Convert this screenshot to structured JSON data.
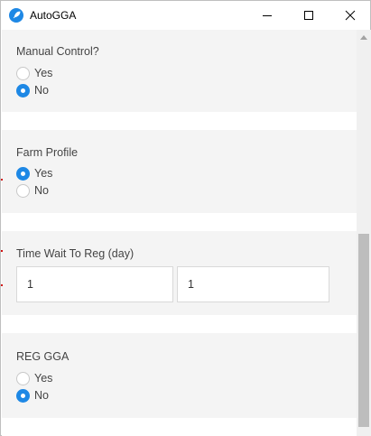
{
  "window": {
    "title": "AutoGGA",
    "icon": "rocket-icon",
    "controls": [
      "minimize-icon",
      "maximize-icon",
      "close-icon"
    ]
  },
  "colors": {
    "accent": "#1e88e5",
    "section_bg": "#f4f4f4",
    "page_bg": "#ffffff"
  },
  "form": {
    "manual_control": {
      "label": "Manual Control?",
      "options": [
        {
          "label": "Yes",
          "selected": false
        },
        {
          "label": "No",
          "selected": true
        }
      ]
    },
    "farm_profile": {
      "label": "Farm Profile",
      "options": [
        {
          "label": "Yes",
          "selected": true
        },
        {
          "label": "No",
          "selected": false
        }
      ]
    },
    "time_wait": {
      "label": "Time Wait To Reg (day)",
      "values": [
        "1",
        "1"
      ]
    },
    "reg_gga": {
      "label": "REG GGA",
      "options": [
        {
          "label": "Yes",
          "selected": false
        },
        {
          "label": "No",
          "selected": true
        }
      ]
    }
  }
}
